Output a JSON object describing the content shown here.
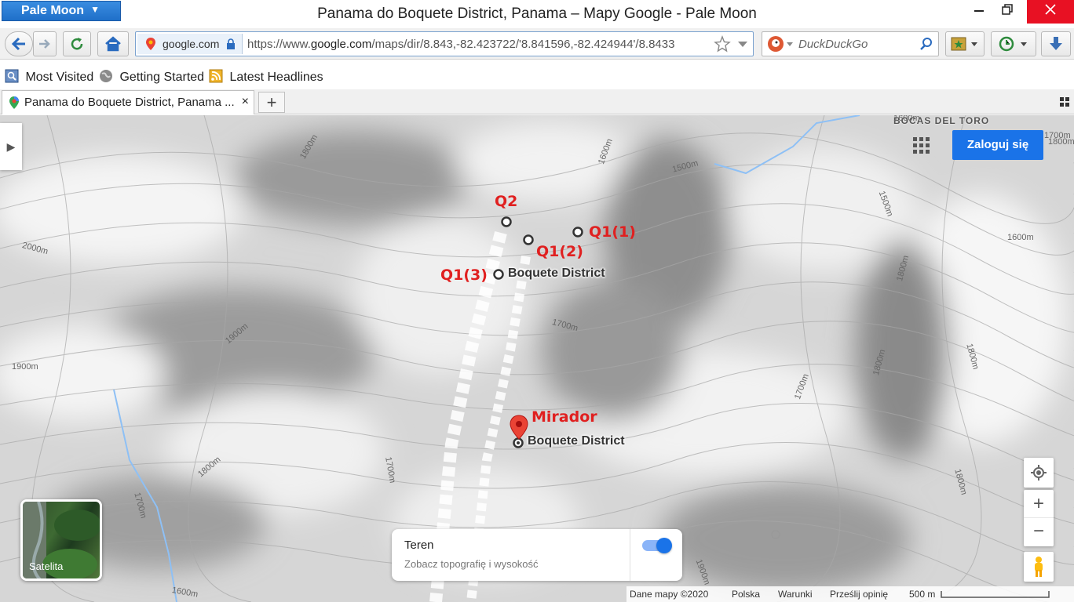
{
  "window": {
    "app_menu": "Pale Moon",
    "title": "Panama do Boquete District, Panama – Mapy Google - Pale Moon"
  },
  "navbar": {
    "identity_domain": "google.com",
    "url_prefix": "https://www.",
    "url_domain": "google.com",
    "url_rest": "/maps/dir/8.843,-82.423722/'8.841596,-82.424944'/8.8433",
    "search_placeholder": "DuckDuckGo"
  },
  "bookmarks": [
    {
      "label": "Most Visited"
    },
    {
      "label": "Getting Started"
    },
    {
      "label": "Latest Headlines"
    }
  ],
  "tab": {
    "label": "Panama do Boquete District, Panama ...",
    "close": "×",
    "new_tab": "+"
  },
  "map": {
    "signin_label": "Zaloguj się",
    "region_label": "BOCAS DEL TORO",
    "markers": [
      {
        "label": "Q2"
      },
      {
        "label": "Q1(1)"
      },
      {
        "label": "Q1(2)"
      },
      {
        "label": "Q1(3)"
      },
      {
        "label": "Mirador"
      }
    ],
    "place_labels": [
      "Boquete District",
      "Boquete District"
    ],
    "contour_labels": [
      "1800m",
      "1600m",
      "1500m",
      "1500m",
      "1600m",
      "2000m",
      "1700m",
      "1900m",
      "1900m",
      "1800m",
      "1700m",
      "1800m",
      "1700m",
      "1800m",
      "1700m",
      "1600m",
      "1800m",
      "1900m",
      "1800m",
      "1700m",
      "1800m",
      "1600m"
    ],
    "satellite_label": "Satelita",
    "terrain_title": "Teren",
    "terrain_subtitle": "Zobacz topografię i wysokość",
    "terrain_enabled": true,
    "zoom_in": "+",
    "zoom_out": "−",
    "footer": {
      "data": "Dane mapy ©2020",
      "country": "Polska",
      "terms": "Warunki",
      "feedback": "Prześlij opinię",
      "scale": "500 m"
    }
  },
  "colors": {
    "accent_blue": "#1a73e8",
    "marker_red": "#e02020",
    "river_blue": "#8ec0f5"
  }
}
